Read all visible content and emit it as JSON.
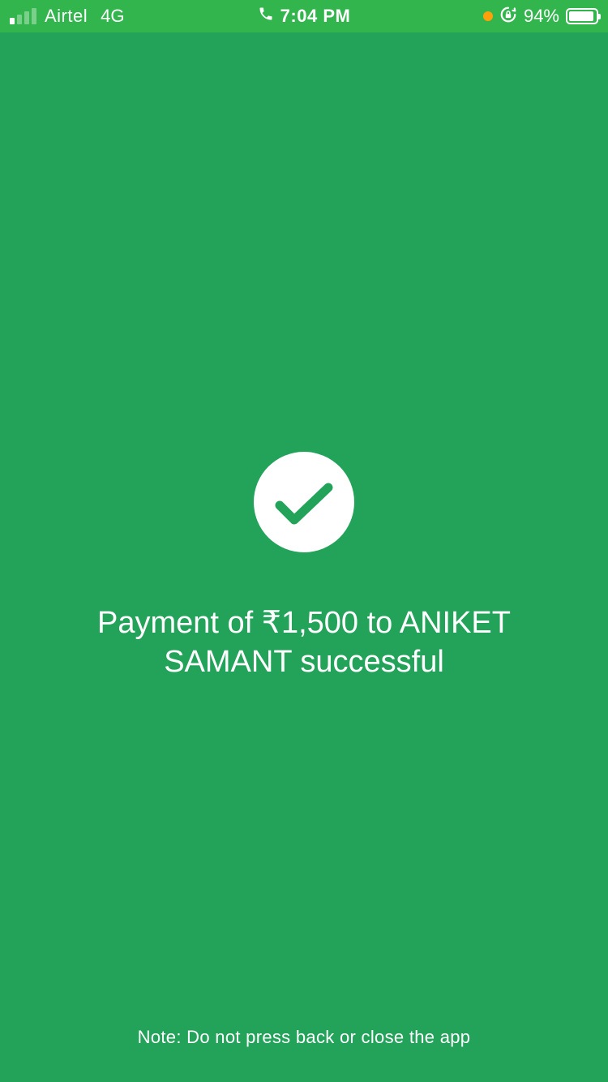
{
  "status_bar": {
    "carrier": "Airtel",
    "network": "4G",
    "time": "7:04 PM",
    "battery_percent_label": "94%",
    "battery_level": 0.94,
    "signal_bars_active": 1,
    "signal_bars_total": 4,
    "icons": [
      "signal-icon",
      "phone-call-icon",
      "recording-dot-icon",
      "rotation-lock-icon",
      "battery-icon"
    ],
    "dot_color": "#ff9f0a"
  },
  "payment": {
    "message": "Payment of ₹1,500 to ANIKET SAMANT successful",
    "icon": "check-icon"
  },
  "note": "Note: Do not press back or close the app",
  "colors": {
    "background": "#23a35a",
    "status_bar": "#33b54e",
    "check": "#23a35a"
  }
}
